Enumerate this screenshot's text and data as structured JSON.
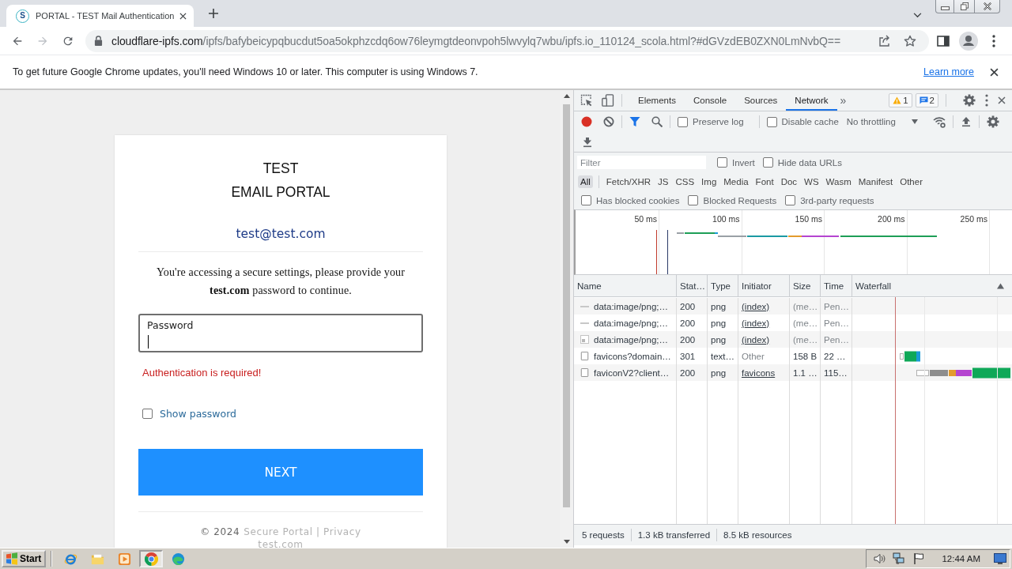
{
  "browser": {
    "tab": {
      "favicon": "S",
      "title": "PORTAL - TEST Mail Authentication"
    },
    "forward": {
      "disabled": true
    },
    "url": {
      "host": "cloudflare-ipfs.com",
      "path": "/ipfs/bafybeicypqbucdut5oa5okphzcdq6ow76leymgtdeonvpoh5lwvylq7wbu/ipfs.io_110124_scola.html?#dGVzdEB0ZXN0LmNvbQ=="
    },
    "infobar": {
      "message": "To get future Google Chrome updates, you'll need Windows 10 or later. This computer is using Windows 7.",
      "link": "Learn more"
    }
  },
  "page": {
    "heading": [
      "TEST",
      "EMAIL PORTAL"
    ],
    "email": "test@test.com",
    "prompt": "You're accessing a secure settings, please provide your **test.com** password to continue.",
    "password_field": {
      "label": "Password",
      "focused": true
    },
    "error": "Authentication is required!",
    "show_password": {
      "label": "Show password",
      "checked": false
    },
    "next_button": "NEXT",
    "footer": {
      "copyright": "© 2024",
      "links": "Secure Portal | Privacy",
      "domain": "test.com"
    }
  },
  "devtools": {
    "panels": [
      {
        "label": "Elements",
        "selected": false
      },
      {
        "label": "Console",
        "selected": false
      },
      {
        "label": "Sources",
        "selected": false
      },
      {
        "label": "Network",
        "selected": true
      }
    ],
    "more_tabs": "»",
    "warnings": "1",
    "messages": "2",
    "toolbar": {
      "recording": true,
      "filter_active": true,
      "options": [
        {
          "label": "Preserve log",
          "checked": false
        },
        {
          "label": "Disable cache",
          "checked": false
        }
      ],
      "throttling": "No throttling"
    },
    "filter": {
      "placeholder": "Filter",
      "options": [
        {
          "label": "Invert",
          "checked": false
        },
        {
          "label": "Hide data URLs",
          "checked": false
        }
      ]
    },
    "types": [
      {
        "label": "All",
        "selected": true
      },
      {
        "label": "Fetch/XHR",
        "selected": false
      },
      {
        "label": "JS",
        "selected": false
      },
      {
        "label": "CSS",
        "selected": false
      },
      {
        "label": "Img",
        "selected": false
      },
      {
        "label": "Media",
        "selected": false
      },
      {
        "label": "Font",
        "selected": false
      },
      {
        "label": "Doc",
        "selected": false
      },
      {
        "label": "WS",
        "selected": false
      },
      {
        "label": "Wasm",
        "selected": false
      },
      {
        "label": "Manifest",
        "selected": false
      },
      {
        "label": "Other",
        "selected": false
      }
    ],
    "more_filters": [
      {
        "label": "Has blocked cookies",
        "checked": false
      },
      {
        "label": "Blocked Requests",
        "checked": false
      },
      {
        "label": "3rd-party requests",
        "checked": false
      }
    ],
    "overview": {
      "ticks": [
        "50 ms",
        "100 ms",
        "150 ms",
        "200 ms",
        "250 ms"
      ]
    },
    "table": {
      "columns": [
        {
          "label": "Name",
          "sorted": false
        },
        {
          "label": "Stat…",
          "sorted": false
        },
        {
          "label": "Type",
          "sorted": false
        },
        {
          "label": "Initiator",
          "sorted": false
        },
        {
          "label": "Size",
          "sorted": false
        },
        {
          "label": "Time",
          "sorted": false
        },
        {
          "label": "Waterfall",
          "sorted": true
        }
      ],
      "rows": [
        {
          "kind": "dash",
          "name": "data:image/png;…",
          "status": "200",
          "type": "png",
          "initiator": "(index)",
          "initiator_link": true,
          "size": "(me…",
          "time": "Pen…",
          "dimmed": true
        },
        {
          "kind": "dash",
          "name": "data:image/png;…",
          "status": "200",
          "type": "png",
          "initiator": "(index)",
          "initiator_link": true,
          "size": "(me…",
          "time": "Pen…",
          "dimmed": true
        },
        {
          "kind": "image",
          "name": "data:image/png;…",
          "status": "200",
          "type": "png",
          "initiator": "(index)",
          "initiator_link": true,
          "size": "(me…",
          "time": "Pen…",
          "dimmed": true
        },
        {
          "kind": "file",
          "name": "favicons?domain…",
          "status": "301",
          "type": "text…",
          "initiator": "Other",
          "initiator_link": false,
          "size": "158 B",
          "time": "22 …",
          "dimmed": false
        },
        {
          "kind": "file",
          "name": "faviconV2?client…",
          "status": "200",
          "type": "png",
          "initiator": "favicons",
          "initiator_link": true,
          "size": "1.1 …",
          "time": "115…",
          "dimmed": false
        }
      ]
    },
    "status": [
      "5 requests",
      "1.3 kB transferred",
      "8.5 kB resources"
    ]
  },
  "taskbar": {
    "start": "Start",
    "apps": [
      {
        "kind": "ie",
        "selected": false
      },
      {
        "kind": "folder",
        "selected": false
      },
      {
        "kind": "media",
        "selected": false
      },
      {
        "kind": "chrome",
        "selected": true
      },
      {
        "kind": "edge",
        "selected": false
      }
    ],
    "clock": "12:44 AM"
  }
}
